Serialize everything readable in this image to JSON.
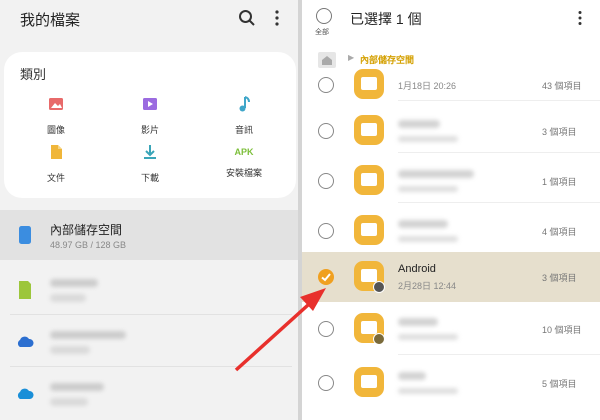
{
  "left": {
    "title": "我的檔案",
    "category_title": "類別",
    "categories": [
      {
        "label": "圖像",
        "icon": "image-icon",
        "color": "#e86a6a"
      },
      {
        "label": "影片",
        "icon": "video-icon",
        "color": "#9b6be0"
      },
      {
        "label": "音訊",
        "icon": "music-icon",
        "color": "#3fa6c9"
      },
      {
        "label": "文件",
        "icon": "document-icon",
        "color": "#f0b63a"
      },
      {
        "label": "下載",
        "icon": "download-icon",
        "color": "#3aa5b8"
      },
      {
        "label": "安裝檔案",
        "icon": "apk-icon",
        "color": "#7cbf3a",
        "icon_text": "APK"
      }
    ],
    "internal_storage": {
      "name": "內部儲存空間",
      "usage": "48.97 GB / 128 GB"
    }
  },
  "right": {
    "all_label": "全部",
    "selection_title": "已選擇 1 個",
    "breadcrumb": "內部儲存空間",
    "rows": [
      {
        "date": "1月18日 20:26",
        "count": "43 個項目",
        "selected": false,
        "badge": false
      },
      {
        "count": "3 個項目",
        "selected": false,
        "badge": false
      },
      {
        "count": "1 個項目",
        "selected": false,
        "badge": false
      },
      {
        "count": "4 個項目",
        "selected": false,
        "badge": false
      },
      {
        "name": "Android",
        "date": "2月28日 12:44",
        "count": "3 個項目",
        "selected": true,
        "badge": true
      },
      {
        "count": "10 個項目",
        "selected": false,
        "badge": true
      },
      {
        "count": "5 個項目",
        "selected": false,
        "badge": false
      }
    ]
  },
  "colors": {
    "accent": "#f0a020",
    "folder": "#f1b63a",
    "arrow": "#e8302c",
    "selected_row": "#e6dfcd"
  }
}
